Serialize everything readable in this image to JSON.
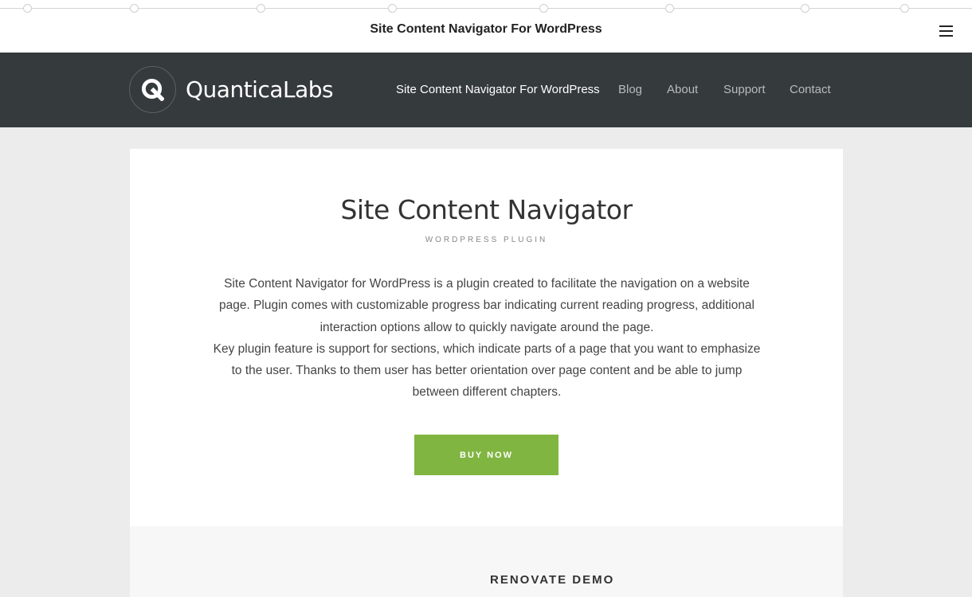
{
  "navigator_bar": {
    "title": "Site Content Navigator For WordPress",
    "section_markers": 8,
    "menu_icon": "hamburger-menu-icon"
  },
  "header": {
    "logo_icon": "quanticalabs-q-logo-icon",
    "logo_text": "QuanticaLabs",
    "nav_items": [
      {
        "label": "Site Content Navigator For WordPress",
        "active": true
      },
      {
        "label": "Blog",
        "active": false
      },
      {
        "label": "About",
        "active": false
      },
      {
        "label": "Support",
        "active": false
      },
      {
        "label": "Contact",
        "active": false
      }
    ]
  },
  "hero": {
    "title": "Site Content Navigator",
    "subtitle": "WORDPRESS PLUGIN",
    "description_paragraphs": [
      "Site Content Navigator for WordPress is a plugin created to facilitate the navigation on a website page. Plugin comes with customizable progress bar indicating current reading progress, additional interaction options allow to quickly navigate around the page.",
      "Key plugin feature is support for sections, which indicate parts of a page that you want to emphasize to the user. Thanks to them user has better orientation over page content and be able to jump between different chapters."
    ],
    "cta_label": "BUY NOW"
  },
  "demo": {
    "title": "RENOVATE DEMO"
  },
  "colors": {
    "header_bg": "#353a3c",
    "page_bg": "#ececec",
    "cta_bg": "#80b541",
    "nav_active": "#ffffff",
    "nav_inactive": "#b8bbbc"
  }
}
